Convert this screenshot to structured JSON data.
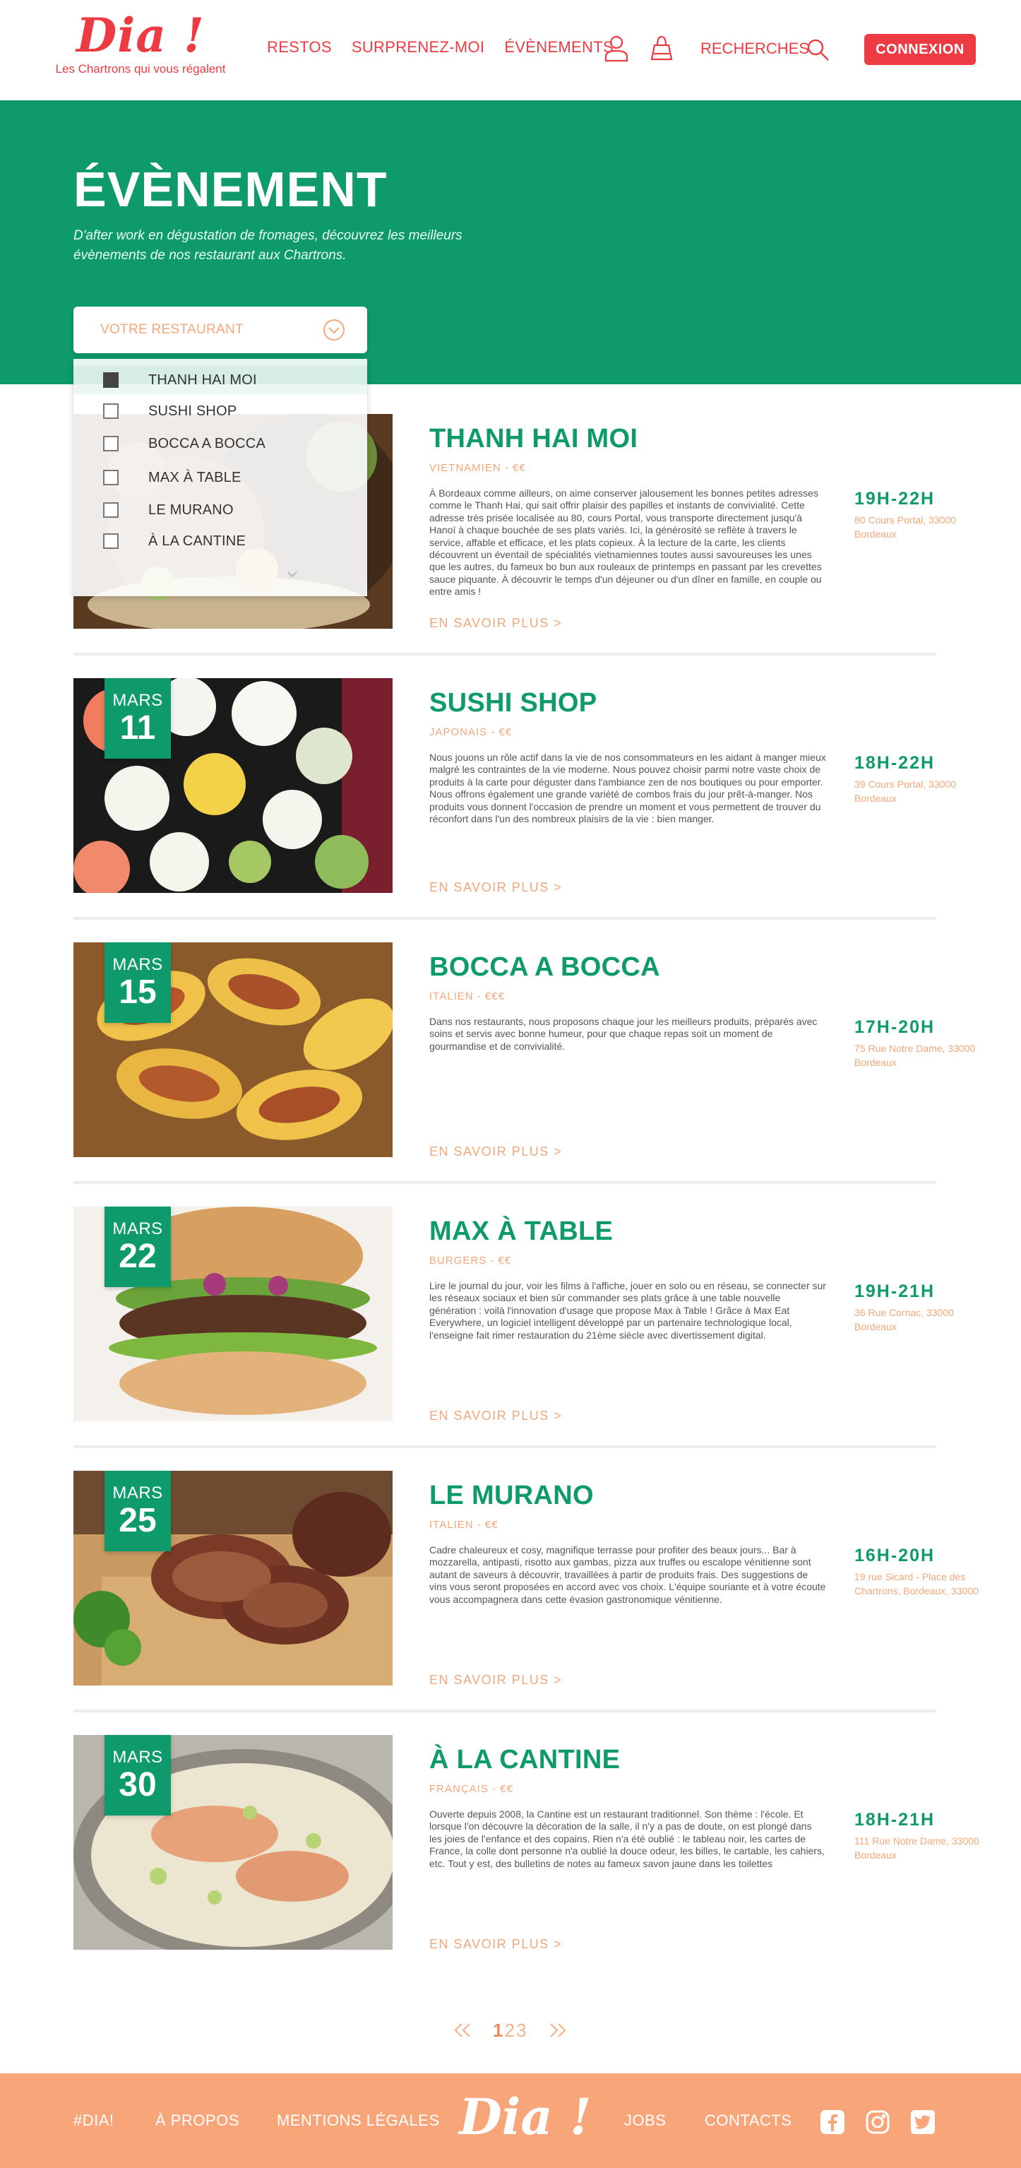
{
  "header": {
    "logo": "Dia !",
    "tagline": "Les Chartrons qui vous régalent",
    "nav": [
      "RESTOS",
      "SURPRENEZ-MOI",
      "ÉVÈNEMENTS"
    ],
    "search_label": "RECHERCHES",
    "login_label": "CONNEXION",
    "icons": [
      "user-icon",
      "bag-icon",
      "search-icon"
    ]
  },
  "hero": {
    "title": "ÉVÈNEMENT",
    "subtitle": "D'after work en dégustation de fromages, découvrez les meilleurs évènements de nos restaurant aux Chartrons."
  },
  "filter": {
    "placeholder": "VOTRE RESTAURANT",
    "options": [
      {
        "label": "THANH HAI MOI",
        "checked": true
      },
      {
        "label": "SUSHI SHOP",
        "checked": false
      },
      {
        "label": "BOCCA A BOCCA",
        "checked": false
      },
      {
        "label": "MAX À TABLE",
        "checked": false
      },
      {
        "label": "LE MURANO",
        "checked": false
      },
      {
        "label": "À LA CANTINE",
        "checked": false
      }
    ]
  },
  "events": [
    {
      "month": "",
      "day": "",
      "name": "THANH HAI MOI",
      "category": "VIETNAMIEN - €€",
      "description": "À Bordeaux comme ailleurs, on aime conserver jalousement les bonnes petites adresses comme le Thanh Hai, qui sait offrir plaisir des papilles et instants de convivialité. Cette adresse très prisée localisée au 80, cours Portal, vous transporte directement jusqu'à Hanoï à chaque bouchée de ses plats variés. Ici, la générosité se reflète à travers le service, affable et efficace, et les plats copieux. À la lecture de la carte, les clients découvrent un éventail de spécialités vietnamiennes toutes aussi savoureuses les unes que les autres, du fameux bo bun aux rouleaux de printemps en passant par les crevettes sauce piquante. À découvrir le temps d'un déjeuner ou d'un dîner en famille, en couple ou entre amis !",
      "time": "19H-22H",
      "address": "80 Cours Portal, 33000 Bordeaux",
      "more": "EN SAVOIR PLUS >",
      "image": "vietnamese-food"
    },
    {
      "month": "MARS",
      "day": "11",
      "name": "SUSHI SHOP",
      "category": "JAPONAIS - €€",
      "description": "Nous jouons un rôle actif dans la vie de nos consommateurs en les aidant à manger mieux malgré les contraintes de la vie moderne. Nous pouvez choisir parmi notre vaste choix de produits à la carte pour déguster dans l'ambiance zen de nos boutiques ou pour emporter. Nous offrons également une grande variété de combos frais du jour prêt-à-manger. Nos produits vous donnent l'occasion de prendre un moment et vous permettent de trouver du réconfort dans l'un des nombreux plaisirs de la vie : bien manger.",
      "time": "18H-22H",
      "address": "39 Cours Portal, 33000 Bordeaux",
      "more": "EN SAVOIR PLUS >",
      "image": "sushi"
    },
    {
      "month": "MARS",
      "day": "15",
      "name": "BOCCA A BOCCA",
      "category": "ITALIEN - €€€",
      "description": "Dans nos restaurants, nous proposons chaque jour les meilleurs produits, préparés avec soins et servis avec bonne humeur, pour que chaque repas soit un moment de gourmandise et de convivialité.",
      "time": "17H-20H",
      "address": "75 Rue Notre Dame, 33000 Bordeaux",
      "more": "EN SAVOIR PLUS >",
      "image": "stuffed-pasta"
    },
    {
      "month": "MARS",
      "day": "22",
      "name": "MAX À TABLE",
      "category": "BURGERS - €€",
      "description": "Lire le journal du jour, voir les films à l'affiche, jouer en solo ou en réseau, se connecter sur les réseaux sociaux et bien sûr commander ses plats grâce à une table nouvelle génération : voilà l'innovation d'usage que propose Max à Table ! Grâce à Max Eat Everywhere, un logiciel intelligent développé par un partenaire technologique local, l'enseigne fait rimer restauration du 21ème siècle avec divertissement digital.",
      "time": "19H-21H",
      "address": "36 Rue Cornac, 33000 Bordeaux",
      "more": "EN SAVOIR PLUS >",
      "image": "burger"
    },
    {
      "month": "MARS",
      "day": "25",
      "name": "LE MURANO",
      "category": "ITALIEN - €€",
      "description": "Cadre chaleureux et cosy, magnifique terrasse pour profiter des beaux jours... Bar à mozzarella, antipasti, risotto aux gambas, pizza aux truffes ou escalope vénitienne sont autant de saveurs à découvrir, travaillées à partir de produits frais. Des suggestions de vins vous seront proposées en accord avec vos choix. L'équipe souriante et à votre écoute vous accompagnera dans cette évasion gastronomique vénitienne.",
      "time": "16H-20H",
      "address": "19 rue Sicard - Place des Chartrons, Bordeaux, 33000",
      "more": "EN SAVOIR PLUS >",
      "image": "meatloaf"
    },
    {
      "month": "MARS",
      "day": "30",
      "name": "À LA CANTINE",
      "category": "FRANÇAIS - €€",
      "description": "Ouverte depuis 2008, la Cantine est un restaurant traditionnel. Son thème : l'école. Et lorsque l'on découvre la décoration de la salle, il n'y a pas de doute, on est plongé dans les joies de l'enfance et des copains. Rien n'a été oublié : le tableau noir, les cartes de France, la colle dont personne n'a oublié la douce odeur, les billes, le cartable, les cahiers, etc. Tout y est, des bulletins de notes au fameux savon jaune dans les toilettes",
      "time": "18H-21H",
      "address": "111 Rue Notre Dame, 33000 Bordeaux",
      "more": "EN SAVOIR PLUS >",
      "image": "fish-soup"
    }
  ],
  "pagination": {
    "pages": [
      "1",
      "2",
      "3"
    ],
    "current": "1",
    "prev_icon": "double-chevron-left-icon",
    "next_icon": "double-chevron-right-icon"
  },
  "footer": {
    "links": [
      "#DIA!",
      "À PROPOS",
      "MENTIONS LÉGALES",
      "JOBS",
      "CONTACTS"
    ],
    "logo": "Dia !",
    "social_icons": [
      "facebook-icon",
      "instagram-icon",
      "twitter-icon"
    ]
  },
  "colors": {
    "brand_red": "#ee3b43",
    "brand_green": "#0e9a6a",
    "accent_peach": "#f8a679",
    "light_orange_text": "#f3a77a"
  }
}
